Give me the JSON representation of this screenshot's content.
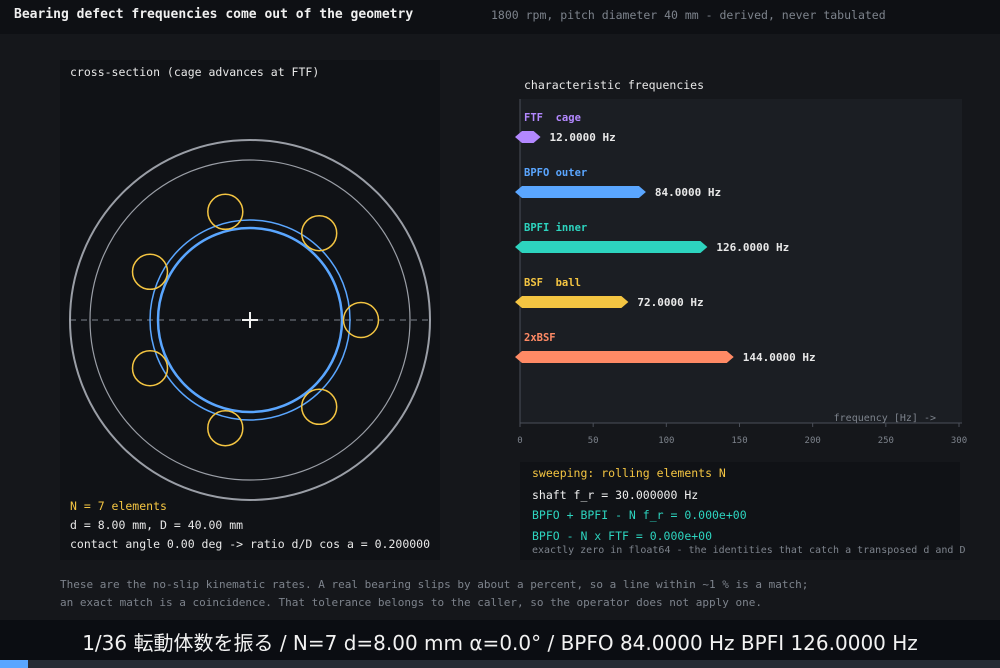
{
  "header": {
    "title": "Bearing defect frequencies come out of the geometry",
    "subtitle": "1800 rpm, pitch diameter 40 mm - derived, never tabulated"
  },
  "bearing": {
    "panel_title": "cross-section (cage advances at FTF)",
    "elements_text": "N = 7 elements",
    "dims_text": "d = 8.00 mm, D = 40.00 mm",
    "angle_text": "contact angle 0.00 deg  ->  ratio d/D cos a = 0.200000",
    "element_count": 7,
    "colors": {
      "outer_race": "#9a9ea6",
      "inner_race": "#5aa6ff",
      "ball": "#f4c542"
    }
  },
  "freq": {
    "panel_title": "characteristic frequencies",
    "axis_label": "frequency [Hz] ->",
    "ticks": [
      "0",
      "50",
      "100",
      "150",
      "200",
      "250",
      "300"
    ],
    "items": [
      {
        "label": "FTF  cage",
        "value_text": "12.0000 Hz",
        "value": 12,
        "color": "#b388ff"
      },
      {
        "label": "BPFO outer",
        "value_text": "84.0000 Hz",
        "value": 84,
        "color": "#5aa6ff"
      },
      {
        "label": "BPFI inner",
        "value_text": "126.0000 Hz",
        "value": 126,
        "color": "#2dd4bf"
      },
      {
        "label": "BSF  ball",
        "value_text": "72.0000 Hz",
        "value": 72,
        "color": "#f4c542"
      },
      {
        "label": "2xBSF",
        "value_text": "144.0000 Hz",
        "value": 144,
        "color": "#ff8a65"
      }
    ]
  },
  "sweep": {
    "heading": "sweeping: rolling elements N",
    "shaft": "shaft f_r = 30.000000 Hz",
    "identity1": "BPFO + BPFI - N f_r = 0.000e+00",
    "identity2": "BPFO - N x FTF     = 0.000e+00",
    "footnote": "exactly zero in float64 - the identities that catch a transposed d and D"
  },
  "notes": {
    "line1": "These are the no-slip kinematic rates. A real bearing slips by about a percent, so a line within ~1 % is a match;",
    "line2": "an exact match is a coincidence. That tolerance belongs to the caller, so the operator does not apply one."
  },
  "caption": "1/36  転動体数を振る  /  N=7  d=8.00 mm  α=0.0°  /  BPFO 84.0000 Hz  BPFI 126.0000 Hz",
  "progress": {
    "fraction": 0.028
  }
}
